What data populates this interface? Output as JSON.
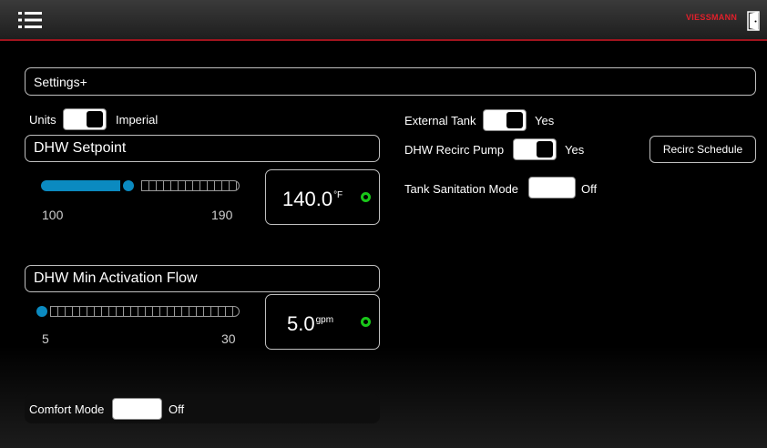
{
  "header": {
    "menu_icon": "hamburger-list-icon",
    "logo_text": "VIESSMANN",
    "exit_icon": "exit-door-icon",
    "accent_color": "#a0141e"
  },
  "page": {
    "title": "Settings+"
  },
  "units": {
    "label": "Units",
    "value": "Imperial",
    "toggle_on": true
  },
  "dhw_setpoint": {
    "title": "DHW Setpoint",
    "min": "100",
    "max": "190",
    "current": 140.0,
    "value_text": "140.0",
    "unit": "°F",
    "status_color": "#19c619"
  },
  "dhw_min_flow": {
    "title": "DHW Min Activation Flow",
    "min": "5",
    "max": "30",
    "current": 5.0,
    "value_text": "5.0",
    "unit": "gpm",
    "status_color": "#19c619"
  },
  "comfort_mode": {
    "label": "Comfort Mode",
    "value": "Off",
    "toggle_on": false
  },
  "external_tank": {
    "label": "External Tank",
    "value": "Yes",
    "toggle_on": true
  },
  "dhw_recirc_pump": {
    "label": "DHW Recirc Pump",
    "value": "Yes",
    "toggle_on": true
  },
  "recirc_schedule": {
    "label": "Recirc Schedule"
  },
  "tank_sanitation": {
    "label": "Tank Sanitation Mode",
    "value": "Off",
    "toggle_on": false
  }
}
